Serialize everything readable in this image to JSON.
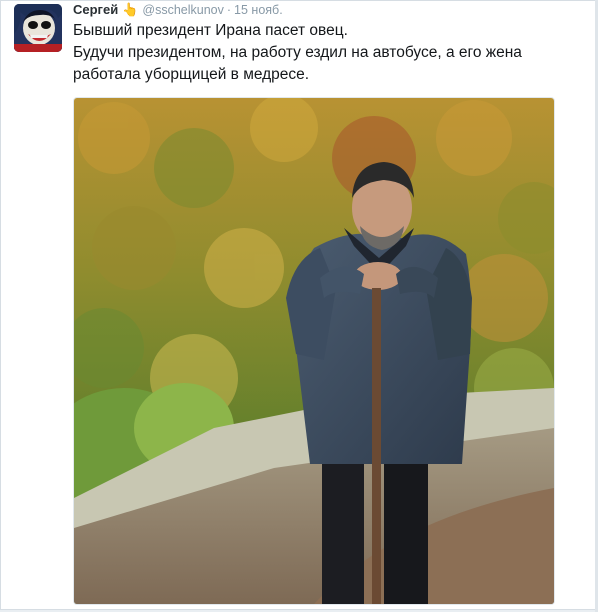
{
  "tweet": {
    "author_name": "Сергей",
    "emoji": "👆",
    "handle": "@sschelkunov",
    "separator": "·",
    "timestamp": "15 нояб.",
    "text_lines": [
      "Бывший президент Ирана пасет овец.",
      "Будучи президентом, на работу ездил на автобусе, а его жена",
      "работала уборщицей в медресе."
    ]
  },
  "icons": {
    "emoji": "raised-hand-pointing-up-icon"
  },
  "colors": {
    "background": "#e9eef2",
    "card": "#ffffff",
    "name": "#292f33",
    "meta": "#8899a6",
    "text": "#14171a"
  }
}
